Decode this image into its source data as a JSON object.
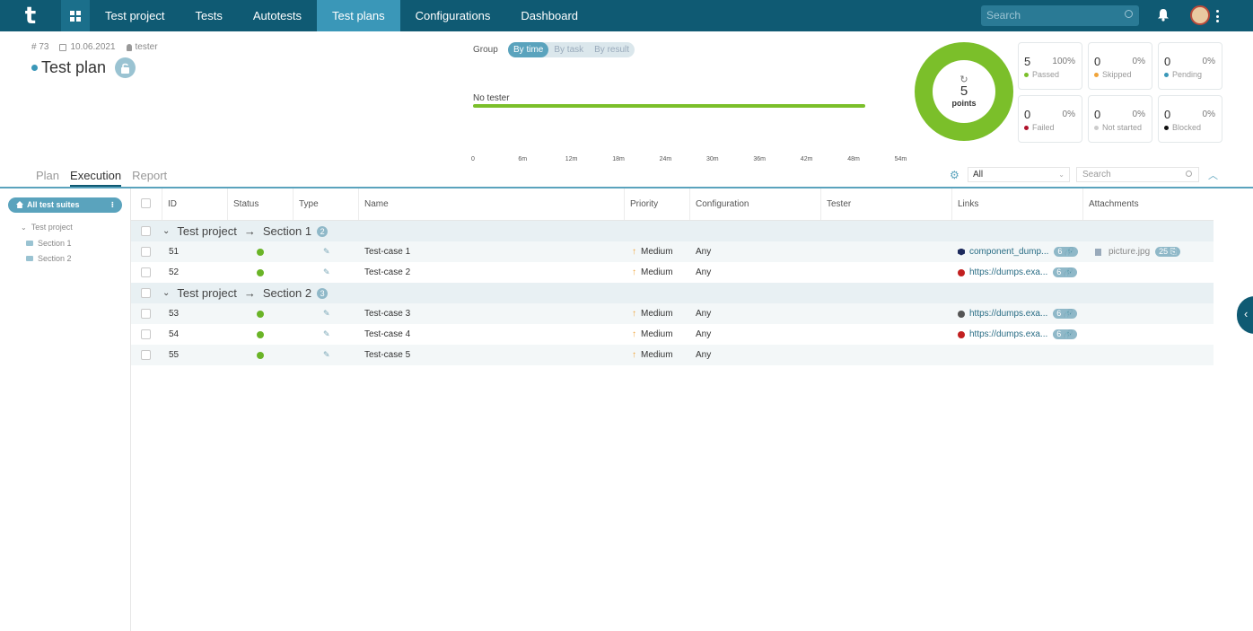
{
  "nav": {
    "logo": "t",
    "items": [
      "Test project",
      "Tests",
      "Autotests",
      "Test plans",
      "Configurations",
      "Dashboard"
    ],
    "active": "Test plans",
    "search_placeholder": "Search"
  },
  "plan": {
    "id": "# 73",
    "date": "10.06.2021",
    "author": "tester",
    "title": "Test plan"
  },
  "group": {
    "label": "Group",
    "options": [
      "By time",
      "By task",
      "By result"
    ],
    "selected": "By time"
  },
  "timeline": {
    "tester_label": "No tester",
    "bar_fraction": 0.81,
    "axis": [
      "0",
      "6m",
      "12m",
      "18m",
      "24m",
      "30m",
      "36m",
      "42m",
      "48m",
      "54m"
    ]
  },
  "summary": {
    "total": "5",
    "total_label": "points",
    "stats": [
      {
        "n": "5",
        "p": "100%",
        "label": "Passed",
        "color": "#7bbf2a"
      },
      {
        "n": "0",
        "p": "0%",
        "label": "Skipped",
        "color": "#f0a43a"
      },
      {
        "n": "0",
        "p": "0%",
        "label": "Pending",
        "color": "#3a97b8"
      },
      {
        "n": "0",
        "p": "0%",
        "label": "Failed",
        "color": "#b0122c"
      },
      {
        "n": "0",
        "p": "0%",
        "label": "Not started",
        "color": "#cccccc"
      },
      {
        "n": "0",
        "p": "0%",
        "label": "Blocked",
        "color": "#111111"
      }
    ]
  },
  "tabs": [
    "Plan",
    "Execution",
    "Report"
  ],
  "active_tab": "Execution",
  "filter": {
    "value": "All",
    "search_placeholder": "Search"
  },
  "sidebar": {
    "root_button": "All test suites",
    "tree": [
      "Test project",
      "Section 1",
      "Section 2"
    ]
  },
  "columns": [
    "ID",
    "Status",
    "Type",
    "Name",
    "Priority",
    "Configuration",
    "Tester",
    "Links",
    "Attachments"
  ],
  "groups": [
    {
      "project": "Test project",
      "section": "Section 1",
      "count": "2",
      "rows": [
        {
          "id": "51",
          "name": "Test-case 1",
          "priority": "Medium",
          "config": "Any",
          "link": "component_dump...",
          "link_count": "6",
          "link_icon": "cube-icon",
          "attachment": "picture.jpg",
          "attachment_count": "25"
        },
        {
          "id": "52",
          "name": "Test-case 2",
          "priority": "Medium",
          "config": "Any",
          "link": "https://dumps.exa...",
          "link_count": "6",
          "link_icon": "bug-icon",
          "attachment": "",
          "attachment_count": ""
        }
      ]
    },
    {
      "project": "Test project",
      "section": "Section 2",
      "count": "3",
      "rows": [
        {
          "id": "53",
          "name": "Test-case 3",
          "priority": "Medium",
          "config": "Any",
          "link": "https://dumps.exa...",
          "link_count": "6",
          "link_icon": "circle-icon",
          "attachment": "",
          "attachment_count": ""
        },
        {
          "id": "54",
          "name": "Test-case 4",
          "priority": "Medium",
          "config": "Any",
          "link": "https://dumps.exa...",
          "link_count": "6",
          "link_icon": "bug-icon",
          "attachment": "",
          "attachment_count": ""
        },
        {
          "id": "55",
          "name": "Test-case 5",
          "priority": "Medium",
          "config": "Any",
          "link": "",
          "link_count": "",
          "link_icon": "",
          "attachment": "",
          "attachment_count": ""
        }
      ]
    }
  ]
}
